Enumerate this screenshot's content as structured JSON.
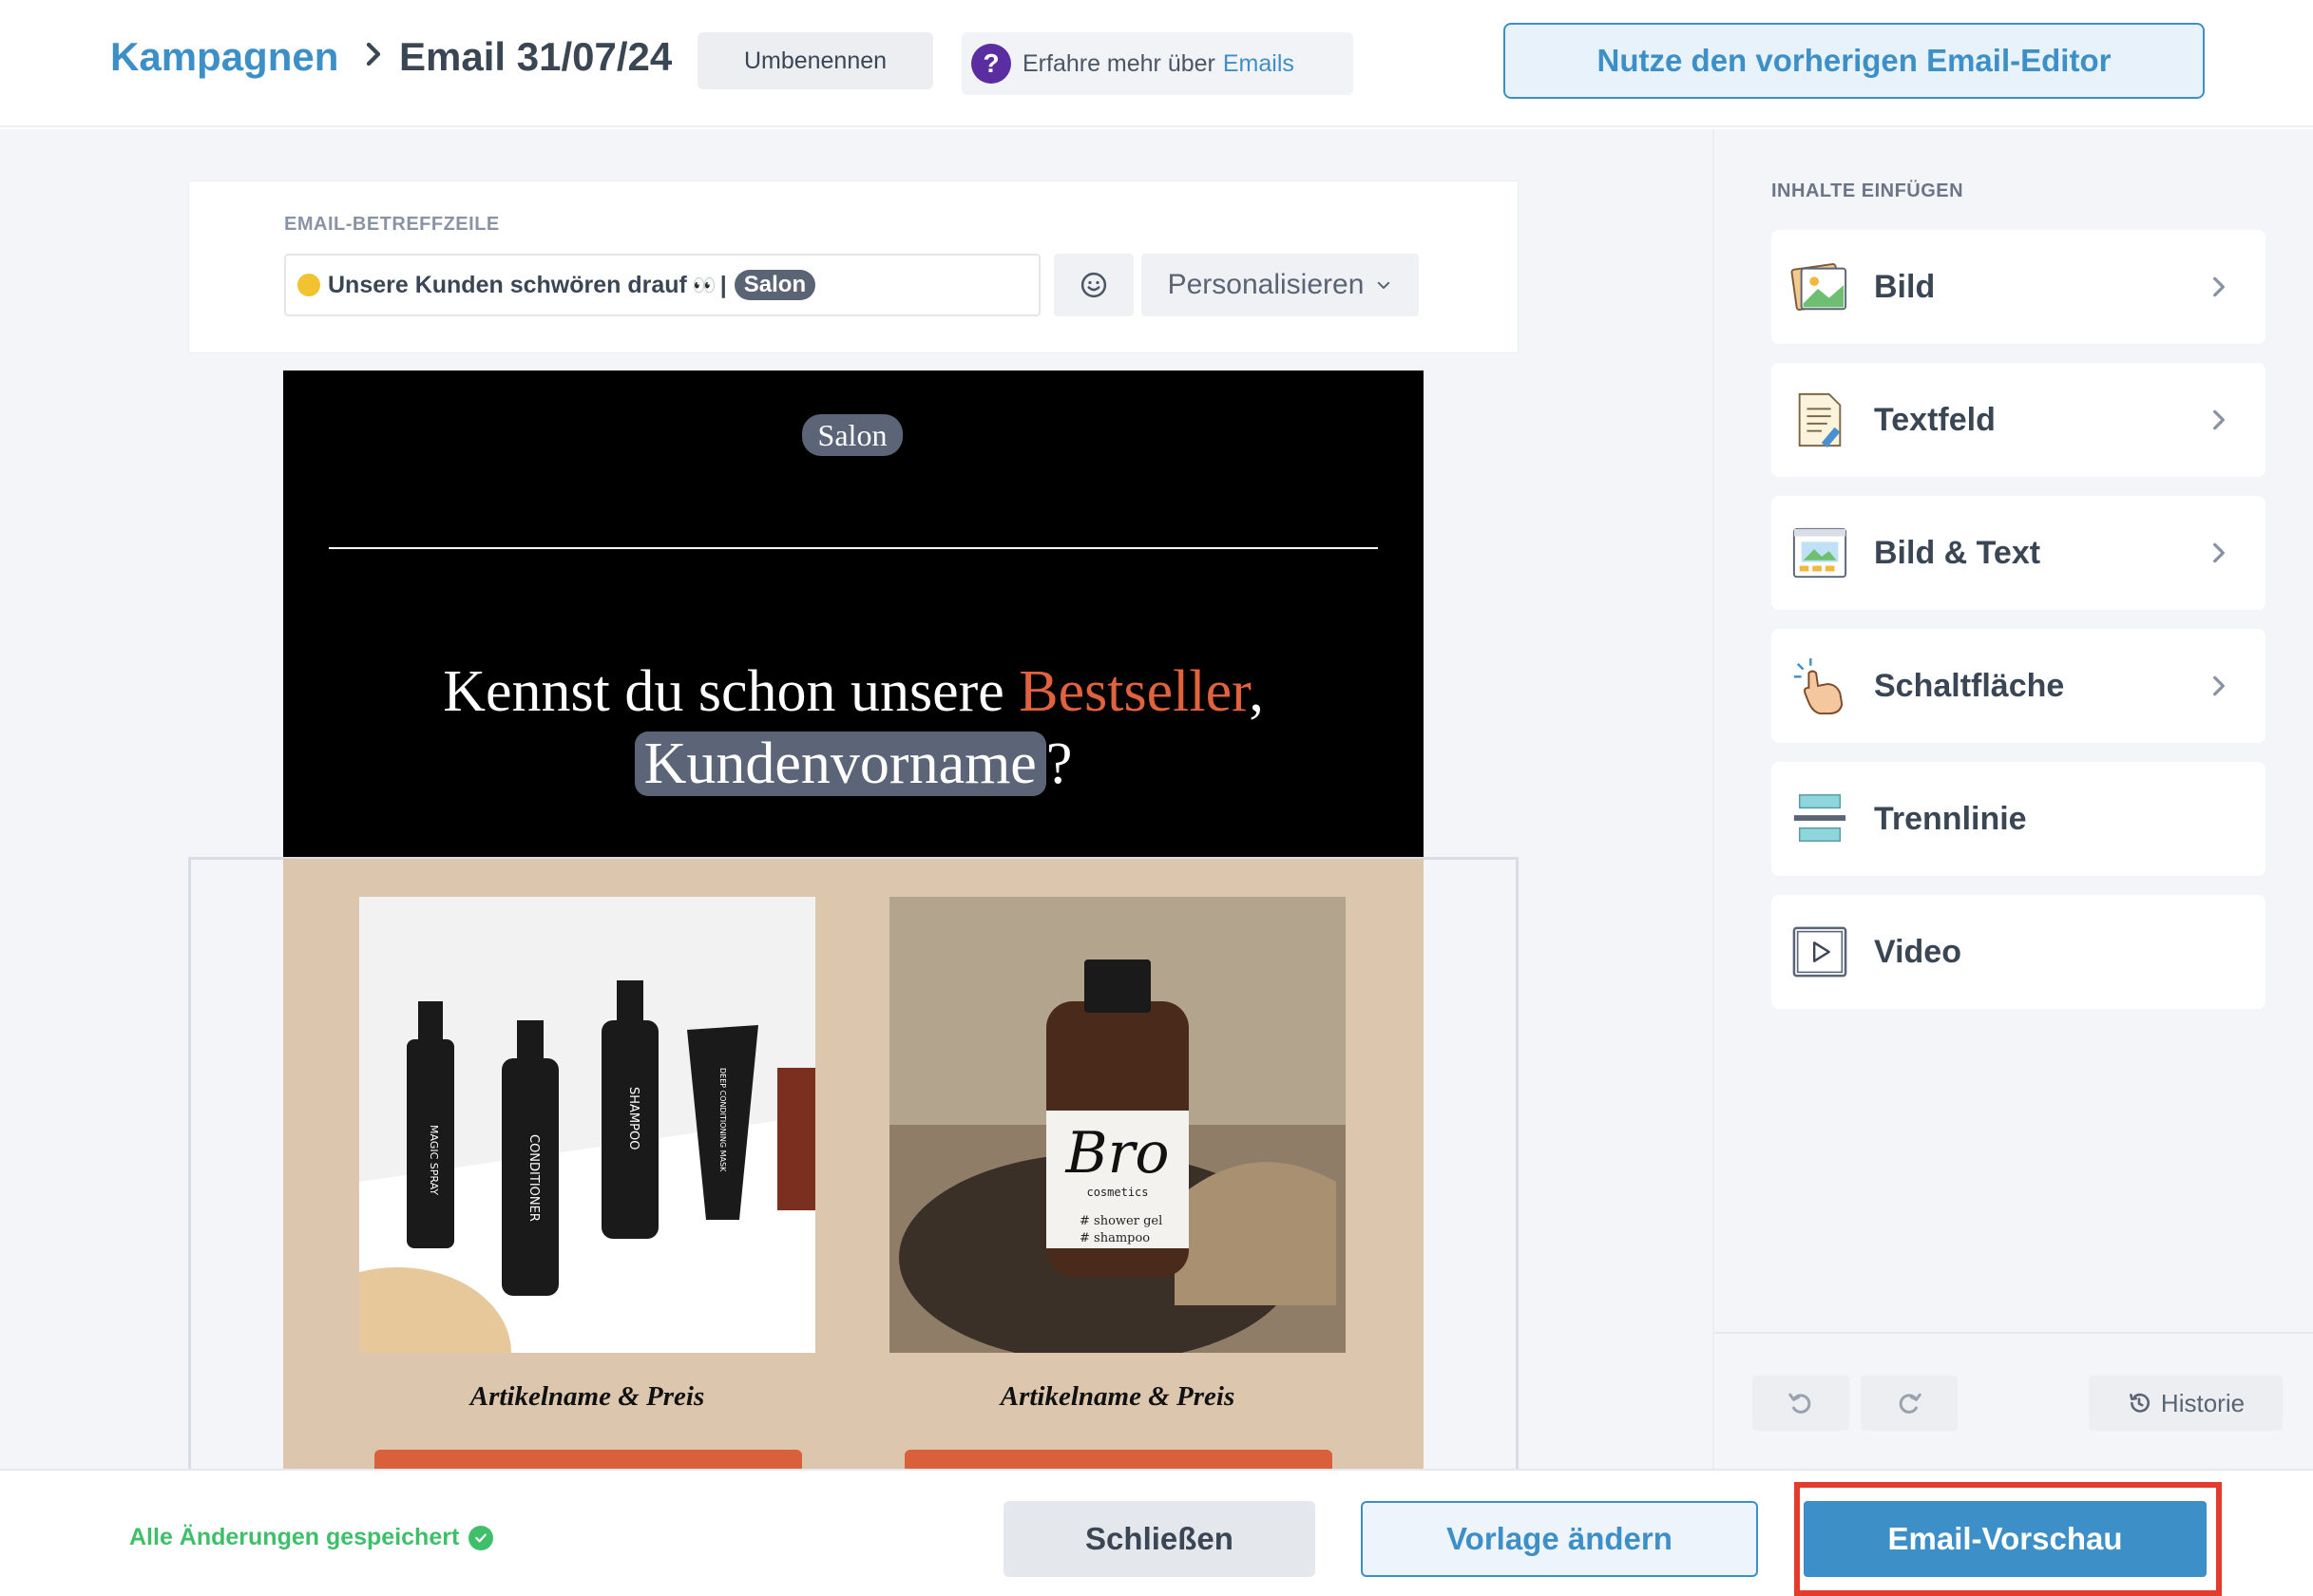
{
  "header": {
    "breadcrumb_parent": "Kampagnen",
    "breadcrumb_current": "Email 31/07/24",
    "rename_label": "Umbenennen",
    "learn_text": "Erfahre mehr über",
    "learn_link": "Emails",
    "help_glyph": "?",
    "prev_editor_label": "Nutze den vorherigen Email-Editor"
  },
  "subject": {
    "label": "EMAIL-BETREFFZEILE",
    "text": "Unsere Kunden schwören drauf",
    "eyes": "👀",
    "separator": "|",
    "tag": "Salon",
    "personalize_label": "Personalisieren"
  },
  "email": {
    "logo_tag": "Salon",
    "headline_part1": "Kennst du schon unsere ",
    "headline_accent": "Bestseller",
    "headline_part2": ",",
    "headline_name_tag": "Kundenvorname",
    "headline_end": "?",
    "products": [
      {
        "name": "Artikelname & Preis",
        "image_labels": [
          "MAGIC SPRAY",
          "CONDITIONER",
          "SHAMPOO",
          "DEEP CONDITIONING MASK"
        ]
      },
      {
        "name": "Artikelname & Preis",
        "image_labels": [
          "Bro",
          "cosmetics",
          "# shower gel",
          "# shampoo"
        ]
      }
    ],
    "colors": {
      "accent": "#e0623f",
      "tag": "#5c6577",
      "product_bg": "#dcc6ad"
    }
  },
  "panel": {
    "title": "INHALTE EINFÜGEN",
    "items": [
      {
        "label": "Bild",
        "icon": "image-icon"
      },
      {
        "label": "Textfeld",
        "icon": "text-field-icon"
      },
      {
        "label": "Bild & Text",
        "icon": "image-text-icon"
      },
      {
        "label": "Schaltfläche",
        "icon": "button-hand-icon"
      },
      {
        "label": "Trennlinie",
        "icon": "divider-icon"
      },
      {
        "label": "Video",
        "icon": "video-icon"
      }
    ],
    "history_label": "Historie"
  },
  "footer": {
    "saved_status": "Alle Änderungen gespeichert",
    "close_label": "Schließen",
    "template_label": "Vorlage ändern",
    "preview_label": "Email-Vorschau"
  },
  "colors": {
    "brand_blue": "#3d8fc8",
    "success_green": "#3fbf6a",
    "highlight_red": "#e33b2e"
  }
}
